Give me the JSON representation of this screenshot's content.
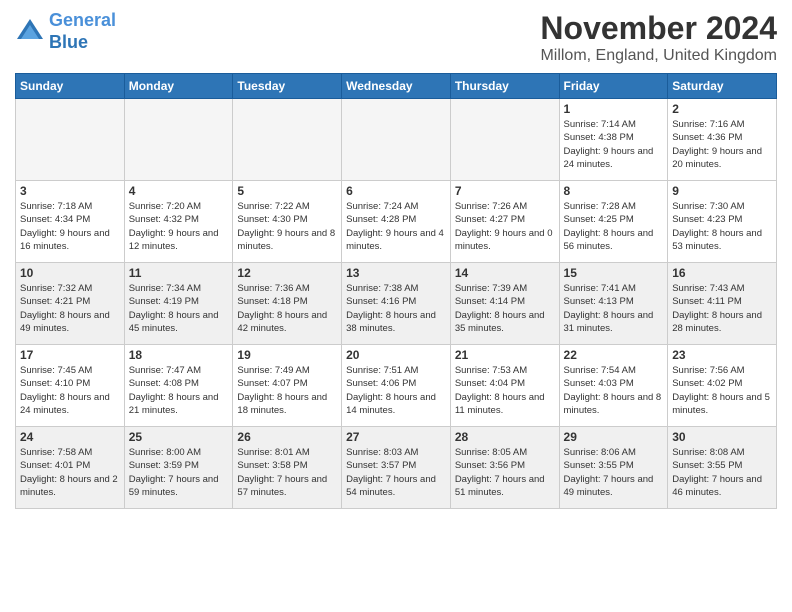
{
  "header": {
    "logo_line1": "General",
    "logo_line2": "Blue",
    "title": "November 2024",
    "subtitle": "Millom, England, United Kingdom"
  },
  "days_of_week": [
    "Sunday",
    "Monday",
    "Tuesday",
    "Wednesday",
    "Thursday",
    "Friday",
    "Saturday"
  ],
  "weeks": [
    [
      {
        "day": "",
        "info": "",
        "empty": true
      },
      {
        "day": "",
        "info": "",
        "empty": true
      },
      {
        "day": "",
        "info": "",
        "empty": true
      },
      {
        "day": "",
        "info": "",
        "empty": true
      },
      {
        "day": "",
        "info": "",
        "empty": true
      },
      {
        "day": "1",
        "info": "Sunrise: 7:14 AM\nSunset: 4:38 PM\nDaylight: 9 hours\nand 24 minutes.",
        "empty": false
      },
      {
        "day": "2",
        "info": "Sunrise: 7:16 AM\nSunset: 4:36 PM\nDaylight: 9 hours\nand 20 minutes.",
        "empty": false
      }
    ],
    [
      {
        "day": "3",
        "info": "Sunrise: 7:18 AM\nSunset: 4:34 PM\nDaylight: 9 hours\nand 16 minutes.",
        "empty": false
      },
      {
        "day": "4",
        "info": "Sunrise: 7:20 AM\nSunset: 4:32 PM\nDaylight: 9 hours\nand 12 minutes.",
        "empty": false
      },
      {
        "day": "5",
        "info": "Sunrise: 7:22 AM\nSunset: 4:30 PM\nDaylight: 9 hours\nand 8 minutes.",
        "empty": false
      },
      {
        "day": "6",
        "info": "Sunrise: 7:24 AM\nSunset: 4:28 PM\nDaylight: 9 hours\nand 4 minutes.",
        "empty": false
      },
      {
        "day": "7",
        "info": "Sunrise: 7:26 AM\nSunset: 4:27 PM\nDaylight: 9 hours\nand 0 minutes.",
        "empty": false
      },
      {
        "day": "8",
        "info": "Sunrise: 7:28 AM\nSunset: 4:25 PM\nDaylight: 8 hours\nand 56 minutes.",
        "empty": false
      },
      {
        "day": "9",
        "info": "Sunrise: 7:30 AM\nSunset: 4:23 PM\nDaylight: 8 hours\nand 53 minutes.",
        "empty": false
      }
    ],
    [
      {
        "day": "10",
        "info": "Sunrise: 7:32 AM\nSunset: 4:21 PM\nDaylight: 8 hours\nand 49 minutes.",
        "empty": false
      },
      {
        "day": "11",
        "info": "Sunrise: 7:34 AM\nSunset: 4:19 PM\nDaylight: 8 hours\nand 45 minutes.",
        "empty": false
      },
      {
        "day": "12",
        "info": "Sunrise: 7:36 AM\nSunset: 4:18 PM\nDaylight: 8 hours\nand 42 minutes.",
        "empty": false
      },
      {
        "day": "13",
        "info": "Sunrise: 7:38 AM\nSunset: 4:16 PM\nDaylight: 8 hours\nand 38 minutes.",
        "empty": false
      },
      {
        "day": "14",
        "info": "Sunrise: 7:39 AM\nSunset: 4:14 PM\nDaylight: 8 hours\nand 35 minutes.",
        "empty": false
      },
      {
        "day": "15",
        "info": "Sunrise: 7:41 AM\nSunset: 4:13 PM\nDaylight: 8 hours\nand 31 minutes.",
        "empty": false
      },
      {
        "day": "16",
        "info": "Sunrise: 7:43 AM\nSunset: 4:11 PM\nDaylight: 8 hours\nand 28 minutes.",
        "empty": false
      }
    ],
    [
      {
        "day": "17",
        "info": "Sunrise: 7:45 AM\nSunset: 4:10 PM\nDaylight: 8 hours\nand 24 minutes.",
        "empty": false
      },
      {
        "day": "18",
        "info": "Sunrise: 7:47 AM\nSunset: 4:08 PM\nDaylight: 8 hours\nand 21 minutes.",
        "empty": false
      },
      {
        "day": "19",
        "info": "Sunrise: 7:49 AM\nSunset: 4:07 PM\nDaylight: 8 hours\nand 18 minutes.",
        "empty": false
      },
      {
        "day": "20",
        "info": "Sunrise: 7:51 AM\nSunset: 4:06 PM\nDaylight: 8 hours\nand 14 minutes.",
        "empty": false
      },
      {
        "day": "21",
        "info": "Sunrise: 7:53 AM\nSunset: 4:04 PM\nDaylight: 8 hours\nand 11 minutes.",
        "empty": false
      },
      {
        "day": "22",
        "info": "Sunrise: 7:54 AM\nSunset: 4:03 PM\nDaylight: 8 hours\nand 8 minutes.",
        "empty": false
      },
      {
        "day": "23",
        "info": "Sunrise: 7:56 AM\nSunset: 4:02 PM\nDaylight: 8 hours\nand 5 minutes.",
        "empty": false
      }
    ],
    [
      {
        "day": "24",
        "info": "Sunrise: 7:58 AM\nSunset: 4:01 PM\nDaylight: 8 hours\nand 2 minutes.",
        "empty": false
      },
      {
        "day": "25",
        "info": "Sunrise: 8:00 AM\nSunset: 3:59 PM\nDaylight: 7 hours\nand 59 minutes.",
        "empty": false
      },
      {
        "day": "26",
        "info": "Sunrise: 8:01 AM\nSunset: 3:58 PM\nDaylight: 7 hours\nand 57 minutes.",
        "empty": false
      },
      {
        "day": "27",
        "info": "Sunrise: 8:03 AM\nSunset: 3:57 PM\nDaylight: 7 hours\nand 54 minutes.",
        "empty": false
      },
      {
        "day": "28",
        "info": "Sunrise: 8:05 AM\nSunset: 3:56 PM\nDaylight: 7 hours\nand 51 minutes.",
        "empty": false
      },
      {
        "day": "29",
        "info": "Sunrise: 8:06 AM\nSunset: 3:55 PM\nDaylight: 7 hours\nand 49 minutes.",
        "empty": false
      },
      {
        "day": "30",
        "info": "Sunrise: 8:08 AM\nSunset: 3:55 PM\nDaylight: 7 hours\nand 46 minutes.",
        "empty": false
      }
    ]
  ]
}
